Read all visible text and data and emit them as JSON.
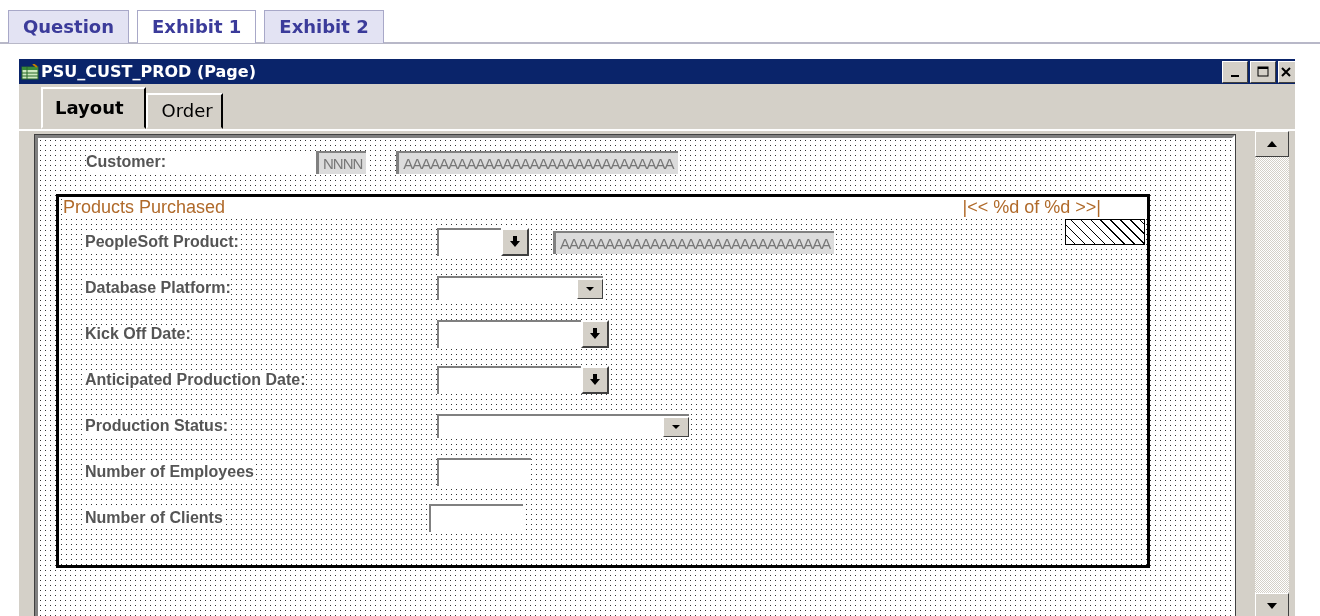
{
  "top_tabs": [
    {
      "label": "Question",
      "selected": false
    },
    {
      "label": "Exhibit 1",
      "selected": true
    },
    {
      "label": "Exhibit 2",
      "selected": false
    }
  ],
  "window": {
    "title": "PSU_CUST_PROD (Page)"
  },
  "page_tabs": [
    {
      "label": "Layout",
      "selected": true
    },
    {
      "label": "Order",
      "selected": false
    }
  ],
  "customer": {
    "label": "Customer:",
    "id_value": "NNNN",
    "name_value": "AAAAAAAAAAAAAAAAAAAAAAAAAAAAAA"
  },
  "group": {
    "title": "Products Purchased",
    "navigation": "|<< %d of %d >>|"
  },
  "fields": [
    {
      "label": "PeopleSoft Product:",
      "kind": "prompt",
      "description": "AAAAAAAAAAAAAAAAAAAAAAAAAAAAAA"
    },
    {
      "label": "Database Platform:",
      "kind": "dropdown"
    },
    {
      "label": "Kick Off Date:",
      "kind": "prompt"
    },
    {
      "label": "Anticipated Production Date:",
      "kind": "prompt"
    },
    {
      "label": "Production Status:",
      "kind": "dropdown"
    },
    {
      "label": "Number of Employees",
      "kind": "edit"
    },
    {
      "label": "Number of Clients",
      "kind": "edit"
    }
  ]
}
